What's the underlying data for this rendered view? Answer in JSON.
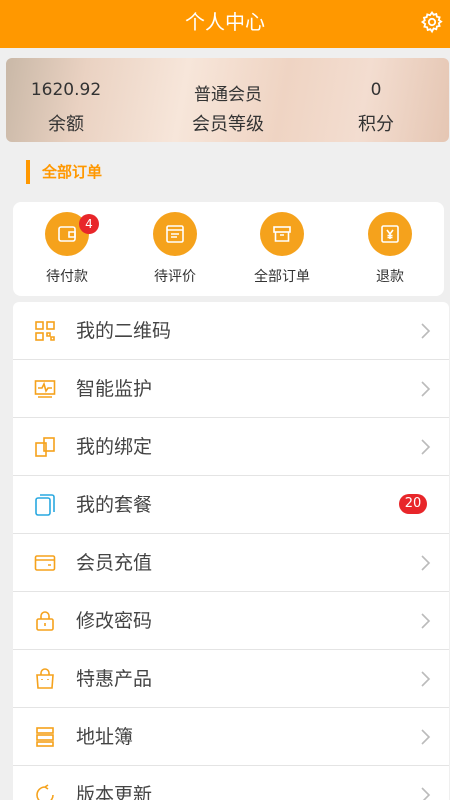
{
  "header": {
    "title": "个人中心",
    "settings_icon": "gear-icon"
  },
  "stats": {
    "balance": {
      "value": "1620.92",
      "label": "余额"
    },
    "level": {
      "value": "普通会员",
      "label": "会员等级"
    },
    "points": {
      "value": "0",
      "label": "积分"
    }
  },
  "orders_section": {
    "title": "全部订单",
    "items": [
      {
        "label": "待付款",
        "icon": "wallet-icon",
        "badge": "4"
      },
      {
        "label": "待评价",
        "icon": "review-icon"
      },
      {
        "label": "全部订单",
        "icon": "box-icon"
      },
      {
        "label": "退款",
        "icon": "refund-icon"
      }
    ]
  },
  "menu": [
    {
      "label": "我的二维码",
      "icon": "qrcode-icon"
    },
    {
      "label": "智能监护",
      "icon": "monitor-icon"
    },
    {
      "label": "我的绑定",
      "icon": "binding-icon"
    },
    {
      "label": "我的套餐",
      "icon": "package-icon",
      "count": "20"
    },
    {
      "label": "会员充值",
      "icon": "card-icon"
    },
    {
      "label": "修改密码",
      "icon": "lock-icon"
    },
    {
      "label": "特惠产品",
      "icon": "bag-icon"
    },
    {
      "label": "地址簿",
      "icon": "address-icon"
    },
    {
      "label": "版本更新",
      "icon": "update-icon"
    }
  ],
  "colors": {
    "accent": "#ff9800",
    "badge": "#e8262a"
  }
}
